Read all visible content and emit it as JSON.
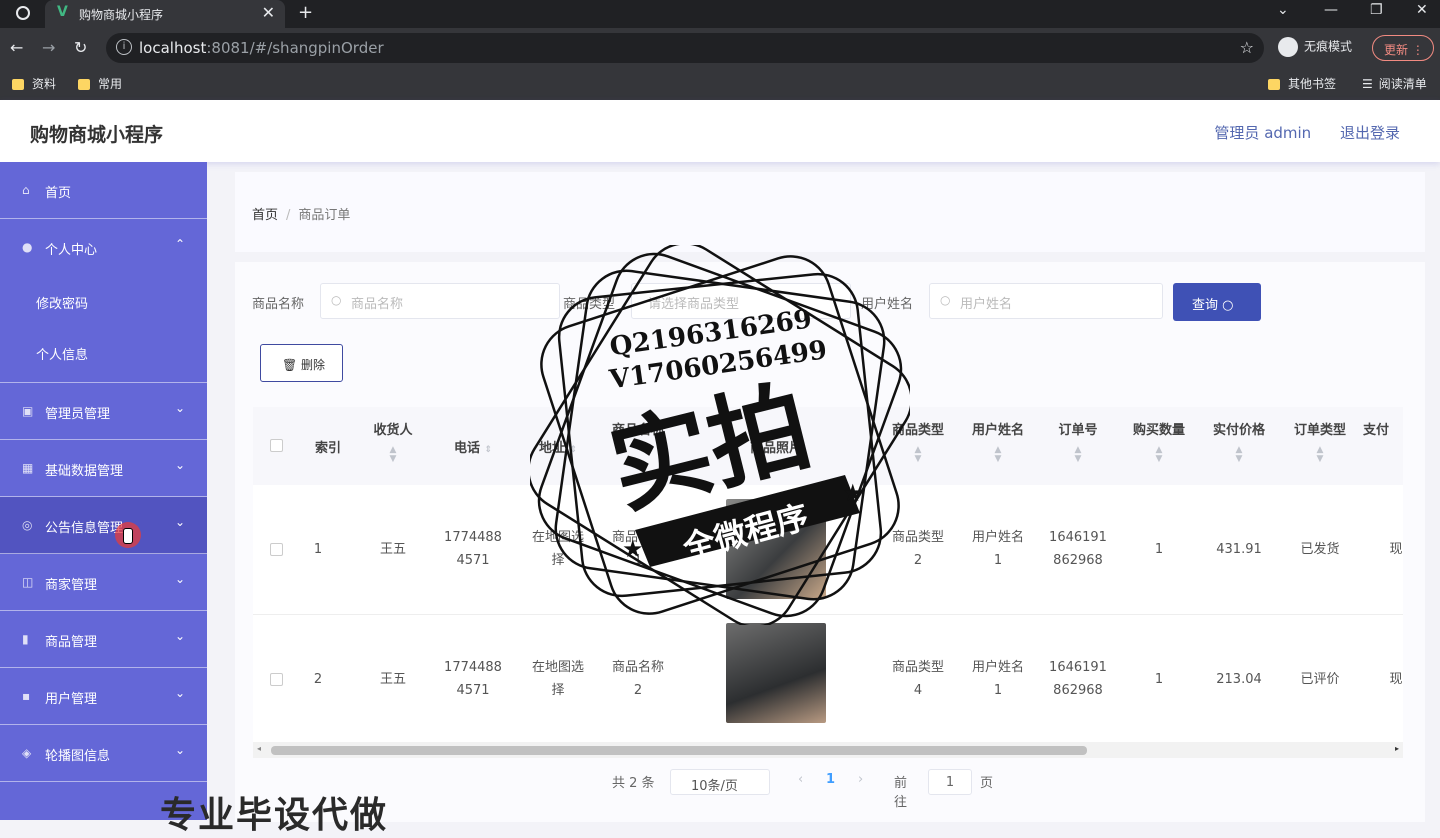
{
  "browser": {
    "tab_title": "购物商城小程序",
    "tab_close": "✕",
    "new_tab": "+",
    "url_host": "localhost",
    "url_rest": ":8081/#/shangpinOrder",
    "incognito_label": "无痕模式",
    "update_label": "更新 ⋮",
    "bookmarks_left": [
      "资料",
      "常用"
    ],
    "bookmarks_right": [
      "其他书签",
      "阅读清单"
    ]
  },
  "header": {
    "brand": "购物商城小程序",
    "user": "管理员 admin",
    "logout": "退出登录"
  },
  "sidebar": {
    "items": [
      {
        "label": "首页",
        "icon": "home-icon",
        "chev": ""
      },
      {
        "label": "个人中心",
        "icon": "user-icon",
        "chev": "⌃"
      },
      {
        "label": "管理员管理",
        "icon": "admin-icon",
        "chev": "⌄"
      },
      {
        "label": "基础数据管理",
        "icon": "grid-icon",
        "chev": "⌄"
      },
      {
        "label": "公告信息管理",
        "icon": "notice-icon",
        "chev": "⌄"
      },
      {
        "label": "商家管理",
        "icon": "shop-icon",
        "chev": "⌄"
      },
      {
        "label": "商品管理",
        "icon": "chart-icon",
        "chev": "⌄"
      },
      {
        "label": "用户管理",
        "icon": "users-icon",
        "chev": "⌄"
      },
      {
        "label": "轮播图信息",
        "icon": "carousel-icon",
        "chev": "⌄"
      }
    ],
    "sub_items": [
      "修改密码",
      "个人信息"
    ]
  },
  "breadcrumb": {
    "home": "首页",
    "sep": "/",
    "current": "商品订单"
  },
  "search": {
    "name_label": "商品名称",
    "name_placeholder": "商品名称",
    "type_label": "商品类型",
    "type_placeholder": "请选择商品类型",
    "user_label": "用户姓名",
    "user_placeholder": "用户姓名",
    "query_button": "查询 ○"
  },
  "toolbar": {
    "delete_label": "🗑 删除"
  },
  "table": {
    "columns": [
      "索引",
      "收货人",
      "电话",
      "地址",
      "商品名称",
      "商品照片",
      "商品类型",
      "用户姓名",
      "订单号",
      "购买数量",
      "实付价格",
      "订单类型",
      "支付"
    ],
    "rows": [
      {
        "index": "1",
        "receiver": "王五",
        "phone_a": "1774488",
        "phone_b": "4571",
        "addr_a": "在地图选",
        "addr_b": "择",
        "name_a": "商品名称",
        "name_b": "1",
        "type_a": "商品类型",
        "type_b": "2",
        "user_a": "用户姓名",
        "user_b": "1",
        "order_a": "1646191",
        "order_b": "862968",
        "qty": "1",
        "price": "431.91",
        "status": "已发货",
        "pay": "现"
      },
      {
        "index": "2",
        "receiver": "王五",
        "phone_a": "1774488",
        "phone_b": "4571",
        "addr_a": "在地图选",
        "addr_b": "择",
        "name_a": "商品名称",
        "name_b": "2",
        "type_a": "商品类型",
        "type_b": "4",
        "user_a": "用户姓名",
        "user_b": "1",
        "order_a": "1646191",
        "order_b": "862968",
        "qty": "1",
        "price": "213.04",
        "status": "已评价",
        "pay": "现"
      }
    ]
  },
  "pagination": {
    "total": "共 2 条",
    "page_size": "10条/页",
    "prev": "‹",
    "current": "1",
    "next": "›",
    "goto": "前往",
    "goto_value": "1",
    "page_unit": "页"
  },
  "overlay": {
    "qq": "Q2196316269",
    "wx": "V17060256499",
    "big": "实拍",
    "banner": "全微程序",
    "bottom_text": "专业毕设代做"
  }
}
